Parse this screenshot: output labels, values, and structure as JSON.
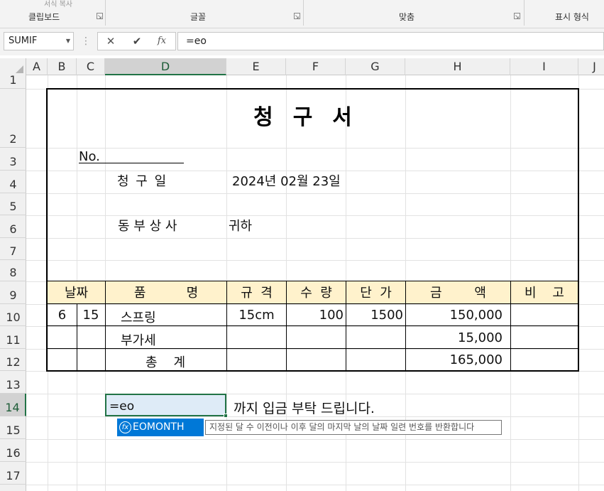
{
  "ribbon": {
    "clipboard": "클립보드",
    "font": "글꼴",
    "alignment": "맞춤",
    "number": "표시 형식",
    "faded_label": "서식 복사"
  },
  "formula_bar": {
    "name_box": "SUMIF",
    "cancel_icon": "✕",
    "enter_icon": "✔",
    "fx_icon": "fx",
    "content": "=eo"
  },
  "columns": [
    "A",
    "B",
    "C",
    "D",
    "E",
    "F",
    "G",
    "H",
    "I",
    "J"
  ],
  "rows": [
    "1",
    "2",
    "3",
    "4",
    "5",
    "6",
    "7",
    "8",
    "9",
    "10",
    "11",
    "12",
    "13",
    "14",
    "15",
    "16",
    "17"
  ],
  "sheet": {
    "title": "청구서",
    "no_label": "No.",
    "claim_date_label": "청 구 일",
    "claim_date": "2024년 02월 23일",
    "customer": "동 부 상 사",
    "honorific": "귀하",
    "headers": {
      "date": "날짜",
      "item": "품          명",
      "spec": "규  격",
      "qty": "수  량",
      "unit_price": "단  가",
      "amount": "금        액",
      "note": "비    고"
    },
    "item_row": {
      "month": "6",
      "day": "15",
      "item": "스프링",
      "spec": "15cm",
      "qty": "100",
      "unit_price": "1500",
      "amount": "150,000"
    },
    "vat_label": "부가세",
    "vat_amount": "15,000",
    "total_label": "총    계",
    "total_amount": "165,000",
    "editing_value": "=eo",
    "payment_note": "까지 입금 부탁 드립니다."
  },
  "autocomplete": {
    "item": "EOMONTH",
    "tooltip": "지정된 달 수 이전이나 이후 달의 마지막 날의 날짜 일련 번호를 반환합니다"
  },
  "colors": {
    "header_fill": "#fff2cc",
    "selection_green": "#217346",
    "active_fill": "#deebf7",
    "autocomplete_blue": "#0078d7"
  }
}
